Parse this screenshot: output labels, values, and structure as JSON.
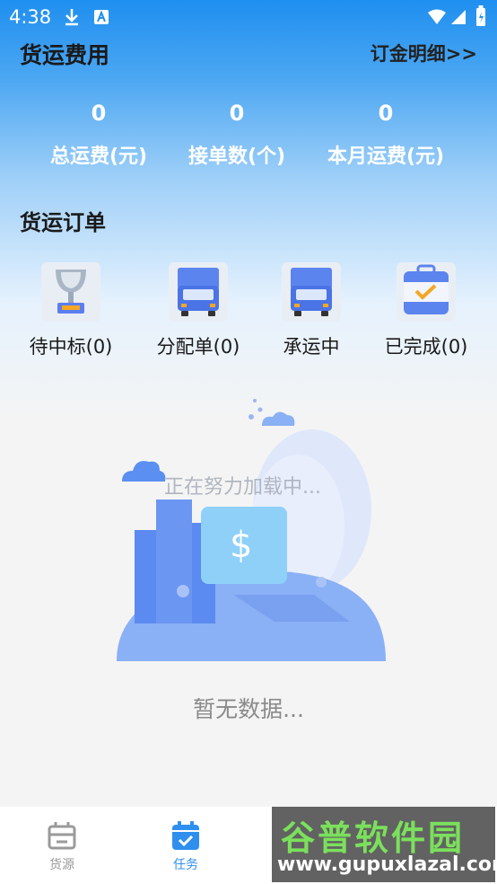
{
  "status_bar": {
    "time": "4:38"
  },
  "header": {
    "title": "货运费用",
    "deposit_link": "订金明细>>"
  },
  "stats": [
    {
      "value": "0",
      "label": "总运费(元)"
    },
    {
      "value": "0",
      "label": "接单数(个)"
    },
    {
      "value": "0",
      "label": "本月运费(元)"
    }
  ],
  "orders": {
    "title": "货运订单",
    "tiles": [
      {
        "label": "待中标(0)",
        "icon": "trophy-icon"
      },
      {
        "label": "分配单(0)",
        "icon": "truck-icon"
      },
      {
        "label": "承运中",
        "icon": "truck-icon"
      },
      {
        "label": "已完成(0)",
        "icon": "bag-check-icon"
      }
    ]
  },
  "empty_state": {
    "loading": "正在努力加载中...",
    "message": "暂无数据..."
  },
  "bottom_nav": [
    {
      "label": "货源",
      "icon": "box-icon",
      "active": false
    },
    {
      "label": "任务",
      "icon": "calendar-check-icon",
      "active": true
    }
  ],
  "watermark": {
    "line1": "谷普软件园",
    "line2": "www.gupuxlazal.com"
  },
  "colors": {
    "accent": "#2f8fef",
    "active_nav": "#2f8fef",
    "inactive_nav": "#999999"
  }
}
